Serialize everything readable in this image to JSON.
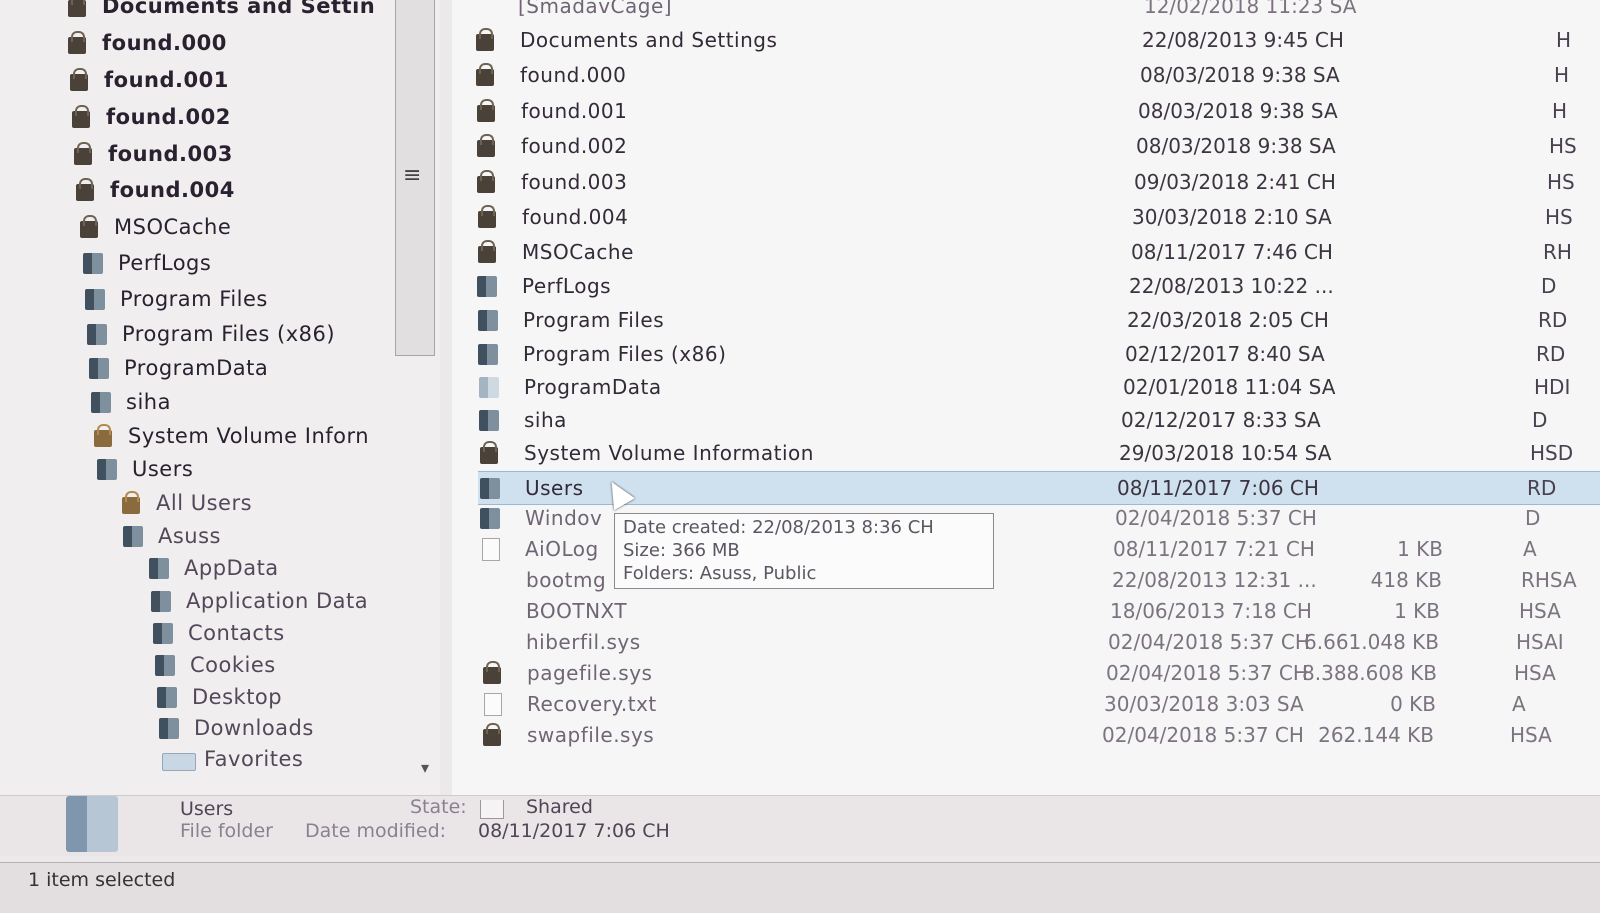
{
  "nav": {
    "items": [
      {
        "label": "Documents and Settin",
        "icon": "locked-folder-icon"
      },
      {
        "label": "found.000",
        "icon": "locked-folder-icon"
      },
      {
        "label": "found.001",
        "icon": "locked-folder-icon"
      },
      {
        "label": "found.002",
        "icon": "locked-folder-icon"
      },
      {
        "label": "found.003",
        "icon": "locked-folder-icon"
      },
      {
        "label": "found.004",
        "icon": "locked-folder-icon"
      },
      {
        "label": "MSOCache",
        "icon": "locked-folder-icon"
      },
      {
        "label": "PerfLogs",
        "icon": "folder-icon"
      },
      {
        "label": "Program Files",
        "icon": "folder-icon"
      },
      {
        "label": "Program Files (x86)",
        "icon": "folder-icon"
      },
      {
        "label": "ProgramData",
        "icon": "folder-icon"
      },
      {
        "label": "siha",
        "icon": "folder-icon"
      },
      {
        "label": "System Volume Inforn",
        "icon": "locked-folder-icon"
      },
      {
        "label": "Users",
        "icon": "folder-icon"
      },
      {
        "label": "All Users",
        "icon": "locked-folder-icon"
      },
      {
        "label": "Asuss",
        "icon": "folder-icon"
      },
      {
        "label": "AppData",
        "icon": "folder-icon"
      },
      {
        "label": "Application Data",
        "icon": "folder-icon"
      },
      {
        "label": "Contacts",
        "icon": "folder-icon"
      },
      {
        "label": "Cookies",
        "icon": "folder-icon"
      },
      {
        "label": "Desktop",
        "icon": "folder-icon"
      },
      {
        "label": "Downloads",
        "icon": "folder-icon"
      },
      {
        "label": "Favorites",
        "icon": "favorites-folder-icon"
      }
    ]
  },
  "files": {
    "top_partial": "[SmadavCage]",
    "top_partial_date": "12/02/2018 11:23 SA",
    "rows": [
      {
        "name": "Documents and Settings",
        "date": "22/08/2013 9:45 CH",
        "size": "",
        "attr": "H"
      },
      {
        "name": "found.000",
        "date": "08/03/2018 9:38 SA",
        "size": "",
        "attr": "H"
      },
      {
        "name": "found.001",
        "date": "08/03/2018 9:38 SA",
        "size": "",
        "attr": "H"
      },
      {
        "name": "found.002",
        "date": "08/03/2018 9:38 SA",
        "size": "",
        "attr": "HS"
      },
      {
        "name": "found.003",
        "date": "09/03/2018 2:41 CH",
        "size": "",
        "attr": "HS"
      },
      {
        "name": "found.004",
        "date": "30/03/2018 2:10 SA",
        "size": "",
        "attr": "HS"
      },
      {
        "name": "MSOCache",
        "date": "08/11/2017 7:46 CH",
        "size": "",
        "attr": "RH"
      },
      {
        "name": "PerfLogs",
        "date": "22/08/2013 10:22 ...",
        "size": "",
        "attr": "D"
      },
      {
        "name": "Program Files",
        "date": "22/03/2018 2:05 CH",
        "size": "",
        "attr": "RD"
      },
      {
        "name": "Program Files (x86)",
        "date": "02/12/2017 8:40 SA",
        "size": "",
        "attr": "RD"
      },
      {
        "name": "ProgramData",
        "date": "02/01/2018 11:04 SA",
        "size": "",
        "attr": "HDI"
      },
      {
        "name": "siha",
        "date": "02/12/2017 8:33 SA",
        "size": "",
        "attr": "D"
      },
      {
        "name": "System Volume Information",
        "date": "29/03/2018 10:54 SA",
        "size": "",
        "attr": "HSD"
      },
      {
        "name": "Users",
        "date": "08/11/2017 7:06 CH",
        "size": "",
        "attr": "RD"
      },
      {
        "name": "Windov",
        "date": "02/04/2018 5:37 CH",
        "size": "",
        "attr": "D"
      },
      {
        "name": "AiOLog",
        "date": "08/11/2017 7:21 CH",
        "size": "1 KB",
        "attr": "A"
      },
      {
        "name": "bootmg",
        "date": "22/08/2013 12:31 ...",
        "size": "418 KB",
        "attr": "RHSA"
      },
      {
        "name": "BOOTNXT",
        "date": "18/06/2013 7:18 CH",
        "size": "1 KB",
        "attr": "HSA"
      },
      {
        "name": "hiberfil.sys",
        "date": "02/04/2018 5:37 CH",
        "size": "6.661.048 KB",
        "attr": "HSAI"
      },
      {
        "name": "pagefile.sys",
        "date": "02/04/2018 5:37 CH",
        "size": "8.388.608 KB",
        "attr": "HSA"
      },
      {
        "name": "Recovery.txt",
        "date": "30/03/2018 3:03 SA",
        "size": "0 KB",
        "attr": "A"
      },
      {
        "name": "swapfile.sys",
        "date": "02/04/2018 5:37 CH",
        "size": "262.144 KB",
        "attr": "HSA"
      }
    ]
  },
  "tooltip": {
    "line1": "Date created: 22/08/2013 8:36 CH",
    "line2": "Size: 366 MB",
    "line3": "Folders: Asuss, Public"
  },
  "details": {
    "name": "Users",
    "type": "File folder",
    "state_label": "State:",
    "state_value": "Shared",
    "modified_label": "Date modified:",
    "modified_value": "08/11/2017 7:06 CH"
  },
  "status": {
    "text": "1 item selected"
  }
}
